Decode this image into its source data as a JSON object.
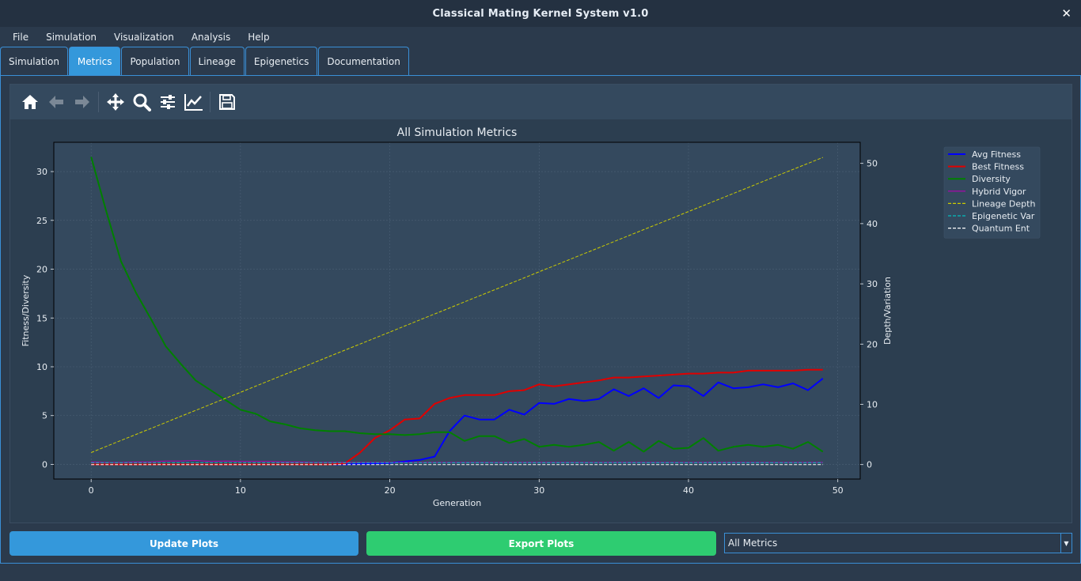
{
  "window": {
    "title": "Classical Mating Kernel System v1.0"
  },
  "menu": [
    "File",
    "Simulation",
    "Visualization",
    "Analysis",
    "Help"
  ],
  "tabs": [
    "Simulation",
    "Metrics",
    "Population",
    "Lineage",
    "Epigenetics",
    "Documentation"
  ],
  "active_tab": "Metrics",
  "toolbar": {
    "icons": [
      "home-icon",
      "back-icon",
      "forward-icon",
      "pan-icon",
      "zoom-icon",
      "configure-subplots-icon",
      "edit-axis-icon",
      "save-icon"
    ]
  },
  "controls": {
    "update_label": "Update Plots",
    "export_label": "Export Plots",
    "metric_selected": "All Metrics"
  },
  "colors": {
    "accent": "#3498db",
    "export": "#2ecc71",
    "chart_bg": "#2c3e50",
    "plot_bg": "#34495e"
  },
  "chart_data": {
    "type": "line",
    "title": "All Simulation Metrics",
    "xlabel": "Generation",
    "ylabel": "Fitness/Diversity",
    "y2label": "Depth/Variation",
    "xlim": [
      -2.5,
      51.5
    ],
    "ylim": [
      -1.5,
      33
    ],
    "y2lim": [
      -2.4,
      53.5
    ],
    "xticks": [
      0,
      10,
      20,
      30,
      40,
      50
    ],
    "yticks": [
      0,
      5,
      10,
      15,
      20,
      25,
      30
    ],
    "y2ticks": [
      0,
      10,
      20,
      30,
      40,
      50
    ],
    "grid": true,
    "legend_position": "outside-right",
    "x": [
      0,
      1,
      2,
      3,
      4,
      5,
      6,
      7,
      8,
      9,
      10,
      11,
      12,
      13,
      14,
      15,
      16,
      17,
      18,
      19,
      20,
      21,
      22,
      23,
      24,
      25,
      26,
      27,
      28,
      29,
      30,
      31,
      32,
      33,
      34,
      35,
      36,
      37,
      38,
      39,
      40,
      41,
      42,
      43,
      44,
      45,
      46,
      47,
      48,
      49
    ],
    "series": [
      {
        "name": "Avg Fitness",
        "axis": "left",
        "color": "#0000ff",
        "style": "solid",
        "width": 2,
        "values": [
          0,
          0,
          0,
          0,
          0,
          0,
          0,
          0,
          0,
          0,
          0,
          0,
          0,
          0,
          0,
          0,
          0,
          0,
          0.05,
          0.1,
          0.15,
          0.3,
          0.45,
          0.8,
          3.4,
          5.0,
          4.6,
          4.6,
          5.6,
          5.1,
          6.3,
          6.2,
          6.7,
          6.5,
          6.7,
          7.7,
          7.0,
          7.8,
          6.8,
          8.1,
          8.0,
          7.0,
          8.4,
          7.8,
          7.9,
          8.2,
          7.9,
          8.3,
          7.6,
          8.8
        ]
      },
      {
        "name": "Best Fitness",
        "axis": "left",
        "color": "#e00000",
        "style": "solid",
        "width": 2,
        "values": [
          0,
          0,
          0,
          0,
          0,
          0,
          0,
          0,
          0,
          0,
          0,
          0,
          0,
          0,
          0,
          0,
          0,
          0.1,
          1.2,
          2.7,
          3.5,
          4.6,
          4.7,
          6.2,
          6.8,
          7.1,
          7.1,
          7.1,
          7.5,
          7.6,
          8.2,
          8.0,
          8.2,
          8.4,
          8.6,
          8.9,
          8.9,
          9.0,
          9.1,
          9.2,
          9.3,
          9.3,
          9.4,
          9.4,
          9.6,
          9.6,
          9.6,
          9.6,
          9.7,
          9.7
        ]
      },
      {
        "name": "Diversity",
        "axis": "left",
        "color": "#008000",
        "style": "solid",
        "width": 2,
        "values": [
          31.5,
          26.0,
          20.8,
          17.6,
          14.9,
          12.1,
          10.3,
          8.6,
          7.6,
          6.6,
          5.6,
          5.2,
          4.4,
          4.1,
          3.7,
          3.5,
          3.4,
          3.4,
          3.2,
          3.1,
          3.1,
          3.0,
          3.1,
          3.3,
          3.3,
          2.4,
          2.9,
          2.9,
          2.2,
          2.6,
          1.8,
          2.0,
          1.8,
          2.0,
          2.3,
          1.4,
          2.3,
          1.3,
          2.4,
          1.6,
          1.7,
          2.7,
          1.4,
          1.8,
          2.0,
          1.8,
          2.0,
          1.6,
          2.3,
          1.3
        ]
      },
      {
        "name": "Hybrid Vigor",
        "axis": "left",
        "color": "#b400b4",
        "style": "solid",
        "width": 1,
        "values": [
          0.25,
          0.2,
          0.2,
          0.25,
          0.25,
          0.35,
          0.35,
          0.4,
          0.3,
          0.35,
          0.3,
          0.3,
          0.3,
          0.25,
          0.25,
          0.2,
          0.2,
          0.2,
          0.2,
          0.2,
          0.2,
          0.2,
          0.2,
          0.2,
          0.2,
          0.2,
          0.2,
          0.2,
          0.2,
          0.2,
          0.2,
          0.2,
          0.2,
          0.2,
          0.2,
          0.2,
          0.2,
          0.2,
          0.2,
          0.2,
          0.2,
          0.2,
          0.2,
          0.2,
          0.2,
          0.2,
          0.2,
          0.2,
          0.2,
          0.2
        ]
      },
      {
        "name": "Lineage Depth",
        "axis": "right",
        "color": "#cccc00",
        "style": "dashed",
        "width": 1,
        "values": [
          2,
          3,
          4,
          5,
          6,
          7,
          8,
          9,
          10,
          11,
          12,
          13,
          14,
          15,
          16,
          17,
          18,
          19,
          20,
          21,
          22,
          23,
          24,
          25,
          26,
          27,
          28,
          29,
          30,
          31,
          32,
          33,
          34,
          35,
          36,
          37,
          38,
          39,
          40,
          41,
          42,
          43,
          44,
          45,
          46,
          47,
          48,
          49,
          50,
          51
        ]
      },
      {
        "name": "Epigenetic Var",
        "axis": "right",
        "color": "#00bfbf",
        "style": "dashed",
        "width": 1,
        "values": [
          0.3,
          0.3,
          0.3,
          0.3,
          0.3,
          0.3,
          0.3,
          0.3,
          0.3,
          0.3,
          0.3,
          0.3,
          0.3,
          0.3,
          0.3,
          0.3,
          0.3,
          0.3,
          0.3,
          0.3,
          0.3,
          0.3,
          0.3,
          0.3,
          0.3,
          0.3,
          0.3,
          0.3,
          0.3,
          0.3,
          0.3,
          0.3,
          0.3,
          0.3,
          0.3,
          0.3,
          0.3,
          0.3,
          0.3,
          0.3,
          0.3,
          0.3,
          0.3,
          0.3,
          0.3,
          0.3,
          0.3,
          0.3,
          0.3,
          0.3
        ]
      },
      {
        "name": "Quantum Ent",
        "axis": "right",
        "color": "#ffffff",
        "style": "dashed",
        "width": 1,
        "values": [
          0,
          0,
          0,
          0,
          0,
          0,
          0,
          0,
          0,
          0,
          0,
          0,
          0,
          0,
          0,
          0,
          0,
          0,
          0,
          0,
          0,
          0,
          0,
          0,
          0,
          0,
          0,
          0,
          0,
          0,
          0,
          0,
          0,
          0,
          0,
          0,
          0,
          0,
          0,
          0,
          0,
          0,
          0,
          0,
          0,
          0,
          0,
          0,
          0,
          0
        ]
      }
    ]
  }
}
